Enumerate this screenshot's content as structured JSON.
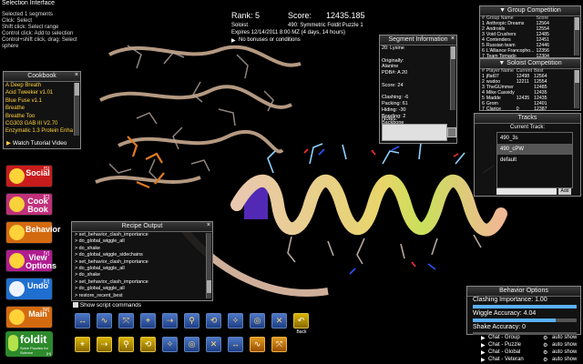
{
  "window": {
    "title": "foldit"
  },
  "selection": {
    "title": "Selection Interface",
    "lines": [
      "Selected 1 segments",
      "Click: Select",
      "Shift click: Select range",
      "Control click: Add to selection",
      "Control+shift click, drag: Select",
      "sphere"
    ]
  },
  "score_header": {
    "rank_label": "Rank:",
    "rank_value": "5",
    "score_label": "Score:",
    "score_value": "12435.185",
    "mode": "Soloist",
    "puzzle": "490: Symmetric Foldit Puzzle 1",
    "expires": "Expires 12/14/2011 8:00 MZ (4 days, 14 hours)",
    "bonus_text": "No bonuses or conditions"
  },
  "cookbook": {
    "title": "Cookbook",
    "items": [
      "A Deep Breath",
      "Acid Tweeker v1.01",
      "Blue Fuse v1.1",
      "Breathe",
      "Breathe Too",
      "CG303 GAB III V2.70",
      "Enzymatic 1.3 Protein Enhan"
    ],
    "tutorial_label": "Watch Tutorial Video"
  },
  "left_buttons": [
    {
      "label": "Social",
      "hotkey": "[S]",
      "bg": "#c81c1c",
      "icon_color": "#ffd23a"
    },
    {
      "label": "Cook Book",
      "hotkey": "[C]",
      "bg": "#c0307a",
      "icon_color": "#f7d23a"
    },
    {
      "label": "Behavior",
      "hotkey": "",
      "bg": "#d36a10",
      "icon_color": "#ffd23a"
    },
    {
      "label": "View Options",
      "hotkey": "[V]",
      "bg": "#b01c90",
      "icon_color": "#ffd23a"
    },
    {
      "label": "Undo",
      "hotkey": "[U]",
      "bg": "#1f6fcf",
      "icon_color": "#eef4ff"
    },
    {
      "label": "Main",
      "hotkey": "[M]",
      "bg": "#d36a10",
      "icon_color": "#ffd23a"
    }
  ],
  "logo": {
    "text": "foldit",
    "tagline": "Solve Puzzles for Science",
    "hotkey": "[H]"
  },
  "segment_info": {
    "title": "Segment Information",
    "lines": [
      "20: Lysine",
      "",
      "Originally:",
      "Alanine",
      "PDB#: A 20",
      "",
      "Score: 24",
      "",
      "Clashing: -6",
      "Packing: 61",
      "Hiding: -30",
      "Bonding: 2",
      "Backbone"
    ],
    "notes_label": "Notes:"
  },
  "recipe_output": {
    "title": "Recipe Output",
    "lines": [
      "> set_behavior_clash_importance",
      "> do_global_wiggle_all",
      "> do_shake",
      "> do_global_wiggle_sidechains",
      "> set_behavior_clash_importance",
      "> do_global_wiggle_all",
      "> do_shake",
      "> set_behavior_clash_importance",
      "> do_global_wiggle_all",
      "> restore_recent_best"
    ],
    "show_script_label": "Show script commands"
  },
  "toolbar": {
    "tools": [
      {
        "glyph": "↔",
        "label": "Shake"
      },
      {
        "glyph": "∿",
        "label": "Wiggle"
      },
      {
        "glyph": "⤧",
        "label": "Rebuild"
      },
      {
        "glyph": "⌖",
        "label": "Tweak"
      },
      {
        "glyph": "⇢",
        "label": "Pull"
      },
      {
        "glyph": "⚲",
        "label": "Mutate"
      },
      {
        "glyph": "⟲",
        "label": "Reset"
      },
      {
        "glyph": "✧",
        "label": "Freeze"
      },
      {
        "glyph": "◎",
        "label": "Band"
      },
      {
        "glyph": "✕",
        "label": "Delete"
      }
    ],
    "back_label": "Back"
  },
  "group_competition": {
    "title": "Group Competition",
    "headers": [
      "#",
      "Group Name",
      "Score"
    ],
    "rows": [
      [
        "1",
        "Anthropic Dreams",
        "12564"
      ],
      [
        "2",
        "Androids",
        "12554"
      ],
      [
        "3",
        "Void Crushers",
        "12485"
      ],
      [
        "4",
        "Contenders",
        "12451"
      ],
      [
        "5",
        "Russian team",
        "12446"
      ],
      [
        "6",
        "L'Alliance Francopho...",
        "12356"
      ],
      [
        "7",
        "Team Tornado",
        "12304"
      ]
    ]
  },
  "soloist_competition": {
    "title": "Soloist Competition",
    "headers": [
      "#",
      "Player Name",
      "Current",
      "Best"
    ],
    "rows": [
      [
        "1",
        "jflat07",
        "12498",
        "12564"
      ],
      [
        "2",
        "wudoo",
        "12211",
        "12554"
      ],
      [
        "3",
        "TheGUmmer",
        "",
        "12485"
      ],
      [
        "4",
        "Mike Cassidy",
        "",
        "12435"
      ],
      [
        "5",
        "Madde",
        "12435",
        "12435"
      ],
      [
        "6",
        "Grom",
        "",
        "12401"
      ],
      [
        "7",
        "Clarice",
        "0",
        "12387"
      ]
    ]
  },
  "tracks": {
    "title": "Tracks",
    "current_track_label": "Current Track:",
    "items": [
      "490_3s",
      "490_cPW",
      "default"
    ],
    "add_label": "Add"
  },
  "behavior_options": {
    "title": "Behavior Options",
    "clash_label": "Clashing Importance: 1.00",
    "clash_level": 1.0,
    "wiggle_label": "Wiggle Accuracy: 4.04",
    "wiggle_level": 0.8,
    "shake_label": "Shake Accuracy: 0",
    "shake_level": 0.0
  },
  "chat": {
    "rows": [
      {
        "label": "Chat - Group",
        "auto": "auto show"
      },
      {
        "label": "Chat - Puzzle",
        "auto": "auto show"
      },
      {
        "label": "Chat - Global",
        "auto": "auto show"
      },
      {
        "label": "Chat - Veteran",
        "auto": "auto show"
      }
    ]
  },
  "colors": {
    "panel_bg": "#151515",
    "accent_blue": "#3a66c4",
    "highlight": "#f0d020"
  }
}
